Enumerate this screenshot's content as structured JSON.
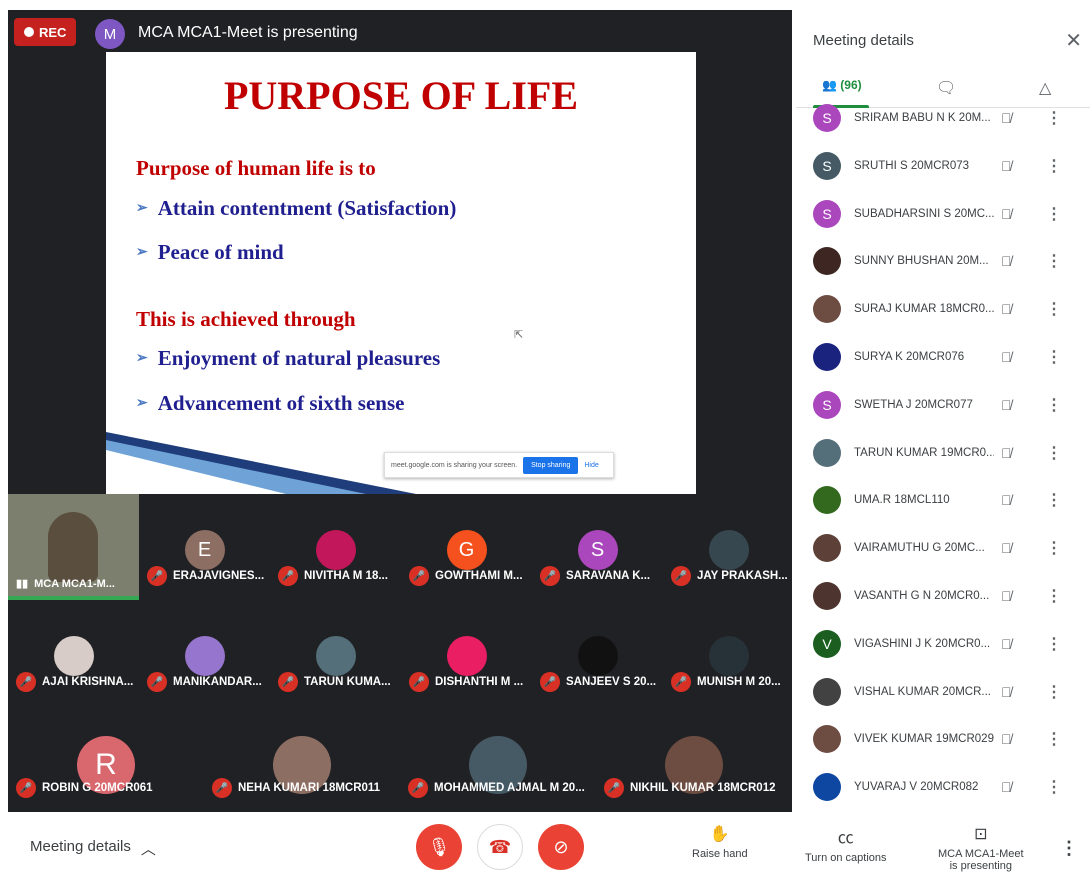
{
  "header": {
    "rec_label": "REC",
    "presenter_initial": "M",
    "presenting_text": "MCA MCA1-Meet is presenting"
  },
  "slide": {
    "title": "PURPOSE OF LIFE",
    "heading1": "Purpose of human life is to",
    "bullet1": "Attain contentment (Satisfaction)",
    "bullet2": "Peace of mind",
    "heading2": "This is achieved through",
    "bullet3": "Enjoyment of natural pleasures",
    "bullet4": "Advancement of sixth sense",
    "share_text": "meet.google.com is sharing your screen.",
    "stop_sharing": "Stop sharing",
    "hide": "Hide"
  },
  "self_tile": {
    "name": "MCA MCA1-M..."
  },
  "tiles": [
    {
      "name": "ERAJAVIGNES...",
      "initial": "E",
      "color": "#8d6e63"
    },
    {
      "name": "NIVITHA M 18...",
      "initial": "",
      "color": "#c2185b"
    },
    {
      "name": "GOWTHAMI M...",
      "initial": "G",
      "color": "#f4511e"
    },
    {
      "name": "SARAVANA K...",
      "initial": "S",
      "color": "#ab47bc"
    },
    {
      "name": "JAY PRAKASH...",
      "initial": "",
      "color": "#37474f"
    },
    {
      "name": "AJAI KRISHNA...",
      "initial": "",
      "color": "#d7ccc8"
    },
    {
      "name": "MANIKANDAR...",
      "initial": "",
      "color": "#9575cd"
    },
    {
      "name": "TARUN KUMA...",
      "initial": "",
      "color": "#546e7a"
    },
    {
      "name": "DISHANTHI M ...",
      "initial": "",
      "color": "#e91e63"
    },
    {
      "name": "SANJEEV S 20...",
      "initial": "",
      "color": "#111111"
    },
    {
      "name": "MUNISH M 20...",
      "initial": "",
      "color": "#263238"
    },
    {
      "name": "ROBIN G 20MCR061",
      "initial": "R",
      "color": "#d8676e"
    },
    {
      "name": "NEHA KUMARI 18MCR011",
      "initial": "",
      "color": "#8d6e63"
    },
    {
      "name": "MOHAMMED AJMAL M 20...",
      "initial": "",
      "color": "#455a64"
    },
    {
      "name": "NIKHIL KUMAR 18MCR012",
      "initial": "",
      "color": "#6d4c41"
    }
  ],
  "panel": {
    "title": "Meeting details",
    "people_count": "(96)",
    "participants": [
      {
        "name": "SRIRAM BABU N K 20M...",
        "initial": "S",
        "color": "#ab47bc"
      },
      {
        "name": "SRUTHI S 20MCR073",
        "initial": "S",
        "color": "#455a64"
      },
      {
        "name": "SUBADHARSINI S 20MC...",
        "initial": "S",
        "color": "#ab47bc"
      },
      {
        "name": "SUNNY BHUSHAN 20M...",
        "initial": "",
        "color": "#3e2723"
      },
      {
        "name": "SURAJ KUMAR 18MCR0...",
        "initial": "",
        "color": "#6d4c41"
      },
      {
        "name": "SURYA K 20MCR076",
        "initial": "",
        "color": "#1a237e"
      },
      {
        "name": "SWETHA J 20MCR077",
        "initial": "S",
        "color": "#ab47bc"
      },
      {
        "name": "TARUN KUMAR 19MCR0...",
        "initial": "",
        "color": "#546e7a"
      },
      {
        "name": "UMA.R 18MCL110",
        "initial": "",
        "color": "#33691e"
      },
      {
        "name": "VAIRAMUTHU G 20MC...",
        "initial": "",
        "color": "#5d4037"
      },
      {
        "name": "VASANTH G N 20MCR0...",
        "initial": "",
        "color": "#4e342e"
      },
      {
        "name": "VIGASHINI J K 20MCR0...",
        "initial": "V",
        "color": "#1b5e20"
      },
      {
        "name": "VISHAL KUMAR 20MCR...",
        "initial": "",
        "color": "#424242"
      },
      {
        "name": "VIVEK KUMAR 19MCR029",
        "initial": "",
        "color": "#6d4c41"
      },
      {
        "name": "YUVARAJ V 20MCR082",
        "initial": "",
        "color": "#0d47a1"
      }
    ]
  },
  "bottom": {
    "meeting_details": "Meeting details",
    "raise_hand": "Raise hand",
    "captions": "Turn on captions",
    "presenting_line1": "MCA MCA1-Meet",
    "presenting_line2": "is presenting"
  }
}
